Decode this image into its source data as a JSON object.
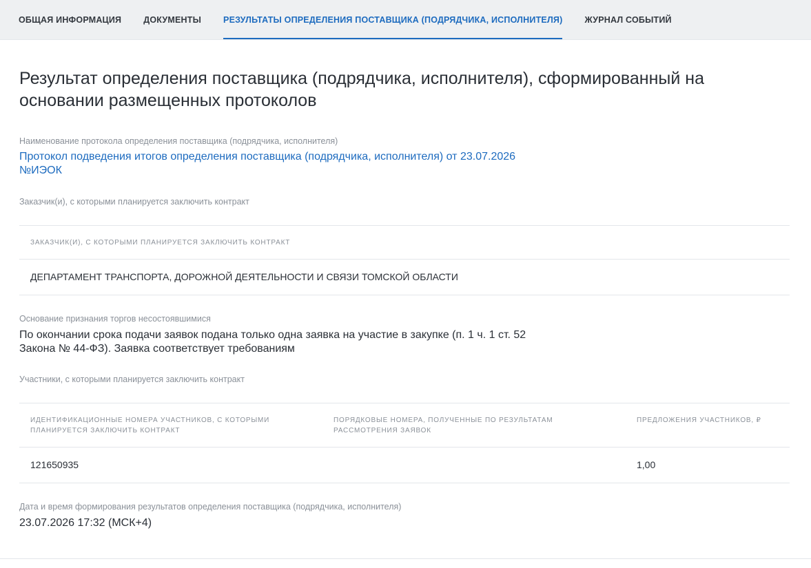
{
  "tabs": [
    {
      "label": "ОБЩАЯ ИНФОРМАЦИЯ",
      "active": false
    },
    {
      "label": "ДОКУМЕНТЫ",
      "active": false
    },
    {
      "label": "РЕЗУЛЬТАТЫ ОПРЕДЕЛЕНИЯ ПОСТАВЩИКА (ПОДРЯДЧИКА, ИСПОЛНИТЕЛЯ)",
      "active": true
    },
    {
      "label": "ЖУРНАЛ СОБЫТИЙ",
      "active": false
    }
  ],
  "page_title": "Результат определения поставщика (подрядчика, исполнителя), сформированный на основании размещенных протоколов",
  "protocol": {
    "label": "Наименование протокола определения поставщика (подрядчика, исполнителя)",
    "link_text": "Протокол подведения итогов определения поставщика (подрядчика, исполнителя) от 23.07.2026 №ИЭОК"
  },
  "customers": {
    "label": "Заказчик(и), с которыми планируется заключить контракт",
    "table_header": "ЗАКАЗЧИК(И), С КОТОРЫМИ ПЛАНИРУЕТСЯ ЗАКЛЮЧИТЬ КОНТРАКТ",
    "rows": [
      "ДЕПАРТАМЕНТ ТРАНСПОРТА, ДОРОЖНОЙ ДЕЯТЕЛЬНОСТИ И СВЯЗИ ТОМСКОЙ ОБЛАСТИ"
    ]
  },
  "failed_reason": {
    "label": "Основание признания торгов несостоявшимися",
    "value": "По окончании срока подачи заявок подана только одна заявка на участие в закупке (п. 1 ч. 1 ст. 52 Закона № 44-ФЗ). Заявка соответствует требованиям"
  },
  "participants": {
    "label": "Участники, с которыми планируется заключить контракт",
    "columns": [
      "ИДЕНТИФИКАЦИОННЫЕ НОМЕРА УЧАСТНИКОВ, С КОТОРЫМИ ПЛАНИРУЕТСЯ ЗАКЛЮЧИТЬ КОНТРАКТ",
      "ПОРЯДКОВЫЕ НОМЕРА, ПОЛУЧЕННЫЕ ПО РЕЗУЛЬТАТАМ РАССМОТРЕНИЯ ЗАЯВОК",
      "ПРЕДЛОЖЕНИЯ УЧАСТНИКОВ, ₽"
    ],
    "rows": [
      {
        "id": "121650935",
        "order": "",
        "offer": "1,00"
      }
    ]
  },
  "result_datetime": {
    "label": "Дата и время формирования результатов определения поставщика (подрядчика, исполнителя)",
    "value": "23.07.2026 17:32 (МСК+4)"
  },
  "colors": {
    "accent": "#1d6bbf",
    "tab_bar_bg": "#eef0f2",
    "muted_text": "#8a9098",
    "divider": "#e3e6ea"
  }
}
